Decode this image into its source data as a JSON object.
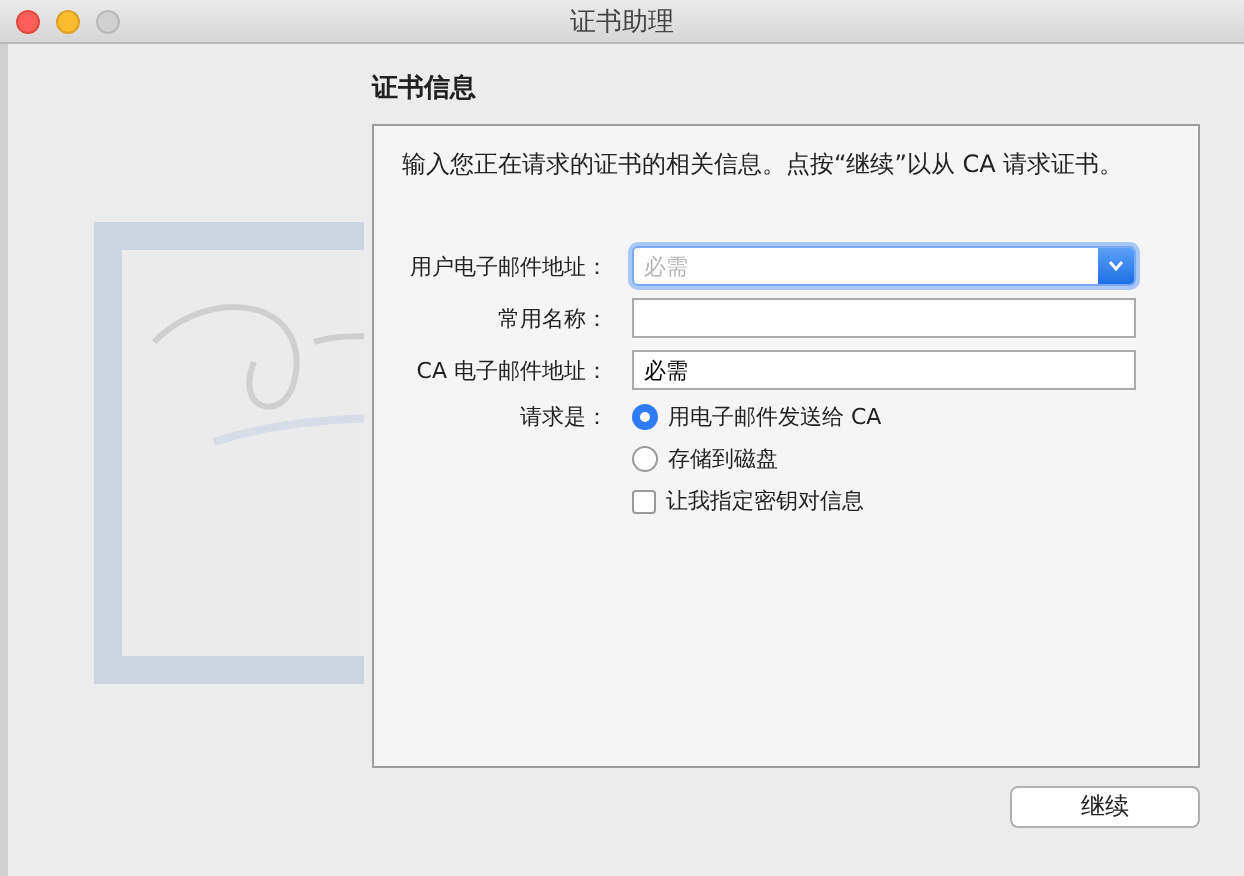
{
  "window": {
    "title": "证书助理"
  },
  "heading": "证书信息",
  "intro": "输入您正在请求的证书的相关信息。点按“继续”以从 CA 请求证书。",
  "fields": [
    {
      "label": "用户电子邮件地址：",
      "kind": "popup",
      "placeholder": "必需"
    },
    {
      "label": "常用名称：",
      "kind": "text"
    },
    {
      "label": "CA 电子邮件地址：",
      "kind": "text",
      "value": "必需"
    }
  ],
  "request": {
    "label": "请求是：",
    "options": [
      {
        "label": "用电子邮件发送给 CA",
        "selected": true
      },
      {
        "label": "存储到磁盘",
        "selected": false
      }
    ],
    "checkbox": {
      "label": "让我指定密钥对信息",
      "checked": false
    }
  },
  "buttons": [
    {
      "label": "继续"
    }
  ]
}
